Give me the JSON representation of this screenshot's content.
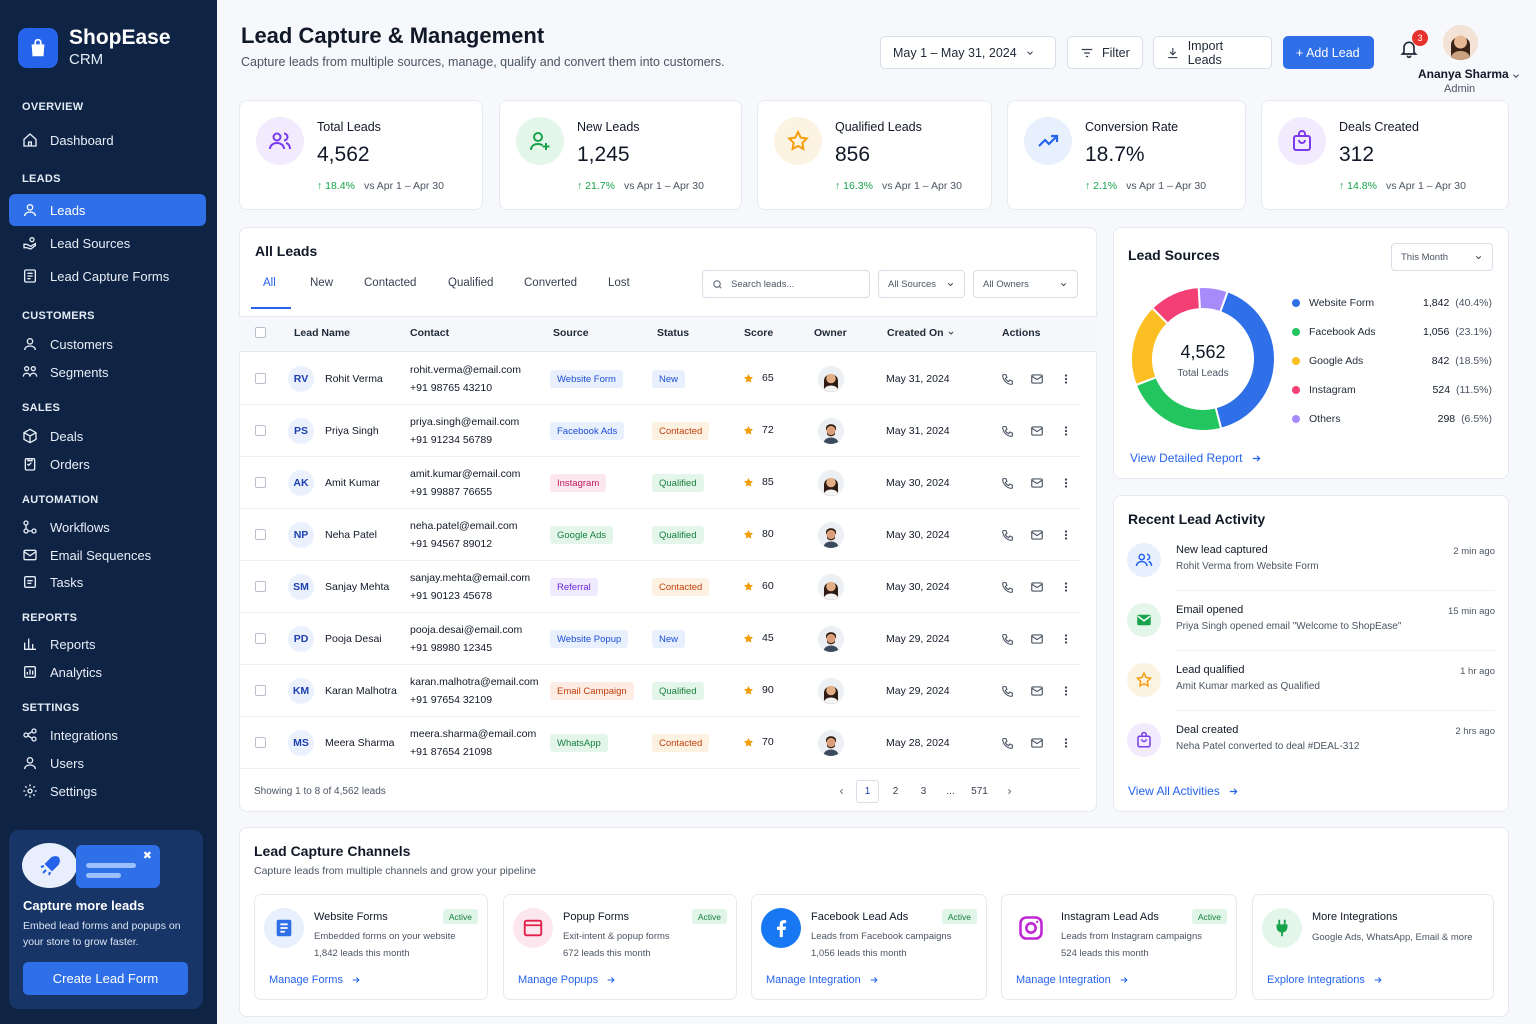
{
  "brand": {
    "name": "ShopEase",
    "sub": "CRM"
  },
  "nav": {
    "overview": "OVERVIEW",
    "dashboard": "Dashboard",
    "leads_section": "LEADS",
    "leads": "Leads",
    "lead_sources": "Lead Sources",
    "lead_capture_forms": "Lead Capture Forms",
    "customers_section": "CUSTOMERS",
    "customers": "Customers",
    "segments": "Segments",
    "sales_section": "SALES",
    "deals": "Deals",
    "orders": "Orders",
    "automation_section": "AUTOMATION",
    "workflows": "Workflows",
    "email_sequences": "Email Sequences",
    "tasks": "Tasks",
    "reports_section": "REPORTS",
    "reports": "Reports",
    "analytics": "Analytics",
    "settings_section": "SETTINGS",
    "integrations": "Integrations",
    "users": "Users",
    "settings": "Settings"
  },
  "promo": {
    "title": "Capture more leads",
    "desc": "Embed lead forms and popups on your store to grow faster.",
    "button": "Create Lead Form"
  },
  "header": {
    "title": "Lead Capture & Management",
    "subtitle": "Capture leads from multiple sources, manage, qualify and convert them into customers.",
    "date_range": "May 1 – May 31, 2024",
    "filter": "Filter",
    "import": "Import Leads",
    "add": "+ Add Lead",
    "notifications": "3",
    "user_name": "Ananya Sharma",
    "user_role": "Admin"
  },
  "stats": [
    {
      "label": "Total Leads",
      "value": "4,562",
      "change": "18.4%",
      "vs": "vs Apr 1 – Apr 30",
      "color": "#7c3aed",
      "bg": "#f1ebfd"
    },
    {
      "label": "New Leads",
      "value": "1,245",
      "change": "21.7%",
      "vs": "vs Apr 1 – Apr 30",
      "color": "#16a34a",
      "bg": "#e4f6ea"
    },
    {
      "label": "Qualified Leads",
      "value": "856",
      "change": "16.3%",
      "vs": "vs Apr 1 – Apr 30",
      "color": "#f59e0b",
      "bg": "#fdf3e2"
    },
    {
      "label": "Conversion Rate",
      "value": "18.7%",
      "change": "2.1%",
      "vs": "vs Apr 1 – Apr 30",
      "color": "#2563eb",
      "bg": "#e8f0fd"
    },
    {
      "label": "Deals Created",
      "value": "312",
      "change": "14.8%",
      "vs": "vs Apr 1 – Apr 30",
      "color": "#7c3aed",
      "bg": "#f1ebfd"
    }
  ],
  "leads": {
    "title": "All Leads",
    "tabs": [
      "All",
      "New",
      "Contacted",
      "Qualified",
      "Converted",
      "Lost"
    ],
    "search_placeholder": "Search leads...",
    "sources_filter": "All Sources",
    "owners_filter": "All Owners",
    "columns": [
      "Lead Name",
      "Contact",
      "Source",
      "Status",
      "Score",
      "Owner",
      "Created On",
      "Actions"
    ],
    "rows": [
      {
        "initials": "RV",
        "name": "Rohit Verma",
        "email": "rohit.verma@email.com",
        "phone": "+91 98765 43210",
        "source": "Website Form",
        "status": "New",
        "score": "65",
        "created": "May 31, 2024",
        "owner": "f"
      },
      {
        "initials": "PS",
        "name": "Priya Singh",
        "email": "priya.singh@email.com",
        "phone": "+91 91234 56789",
        "source": "Facebook Ads",
        "status": "Contacted",
        "score": "72",
        "created": "May 31, 2024",
        "owner": "m"
      },
      {
        "initials": "AK",
        "name": "Amit Kumar",
        "email": "amit.kumar@email.com",
        "phone": "+91 99887 76655",
        "source": "Instagram",
        "status": "Qualified",
        "score": "85",
        "created": "May 30, 2024",
        "owner": "f"
      },
      {
        "initials": "NP",
        "name": "Neha Patel",
        "email": "neha.patel@email.com",
        "phone": "+91 94567 89012",
        "source": "Google Ads",
        "status": "Qualified",
        "score": "80",
        "created": "May 30, 2024",
        "owner": "m"
      },
      {
        "initials": "SM",
        "name": "Sanjay Mehta",
        "email": "sanjay.mehta@email.com",
        "phone": "+91 90123 45678",
        "source": "Referral",
        "status": "Contacted",
        "score": "60",
        "created": "May 30, 2024",
        "owner": "f"
      },
      {
        "initials": "PD",
        "name": "Pooja Desai",
        "email": "pooja.desai@email.com",
        "phone": "+91 98980 12345",
        "source": "Website Popup",
        "status": "New",
        "score": "45",
        "created": "May 29, 2024",
        "owner": "m"
      },
      {
        "initials": "KM",
        "name": "Karan Malhotra",
        "email": "karan.malhotra@email.com",
        "phone": "+91 97654 32109",
        "source": "Email Campaign",
        "status": "Qualified",
        "score": "90",
        "created": "May 29, 2024",
        "owner": "f"
      },
      {
        "initials": "MS",
        "name": "Meera Sharma",
        "email": "meera.sharma@email.com",
        "phone": "+91 87654 21098",
        "source": "WhatsApp",
        "status": "Contacted",
        "score": "70",
        "created": "May 28, 2024",
        "owner": "m"
      }
    ],
    "showing": "Showing 1 to 8 of 4,562 leads",
    "pages": [
      "1",
      "2",
      "3",
      "...",
      "571"
    ]
  },
  "source_colors": {
    "Website Form": {
      "bg": "#e8f0fd",
      "fg": "#1d4ed8"
    },
    "Facebook Ads": {
      "bg": "#e8f0fd",
      "fg": "#1d4ed8"
    },
    "Instagram": {
      "bg": "#fde7ee",
      "fg": "#be185d"
    },
    "Google Ads": {
      "bg": "#e4f6ea",
      "fg": "#15803d"
    },
    "Referral": {
      "bg": "#efeafd",
      "fg": "#6d28d9"
    },
    "Website Popup": {
      "bg": "#e8f0fd",
      "fg": "#1d4ed8"
    },
    "Email Campaign": {
      "bg": "#fdece4",
      "fg": "#c2410c"
    },
    "WhatsApp": {
      "bg": "#e4f6ea",
      "fg": "#15803d"
    }
  },
  "status_colors": {
    "New": {
      "bg": "#e8f0fd",
      "fg": "#1d4ed8"
    },
    "Contacted": {
      "bg": "#fdf1e2",
      "fg": "#c2410c"
    },
    "Qualified": {
      "bg": "#e4f6ea",
      "fg": "#15803d"
    }
  },
  "lead_sources": {
    "title": "Lead Sources",
    "period": "This Month",
    "total": "4,562",
    "total_label": "Total Leads",
    "items": [
      {
        "name": "Website Form",
        "value": 1842,
        "display": "1,842",
        "pct": "(40.4%)",
        "color": "#2f6fe8"
      },
      {
        "name": "Facebook Ads",
        "value": 1056,
        "display": "1,056",
        "pct": "(23.1%)",
        "color": "#22c55e"
      },
      {
        "name": "Google Ads",
        "value": 842,
        "display": "842",
        "pct": "(18.5%)",
        "color": "#fbbf24"
      },
      {
        "name": "Instagram",
        "value": 524,
        "display": "524",
        "pct": "(11.5%)",
        "color": "#f43f74"
      },
      {
        "name": "Others",
        "value": 298,
        "display": "298",
        "pct": "(6.5%)",
        "color": "#a78bfa"
      }
    ],
    "report_link": "View Detailed Report"
  },
  "activity": {
    "title": "Recent Lead Activity",
    "items": [
      {
        "title": "New lead captured",
        "desc": "Rohit Verma from Website Form",
        "time": "2 min ago",
        "icon": "users-icon",
        "color": "#2563eb",
        "bg": "#e8f0fd"
      },
      {
        "title": "Email opened",
        "desc": "Priya Singh opened email \"Welcome to ShopEase\"",
        "time": "15 min ago",
        "icon": "mail-icon",
        "color": "#16a34a",
        "bg": "#e4f6ea"
      },
      {
        "title": "Lead qualified",
        "desc": "Amit Kumar marked as Qualified",
        "time": "1 hr ago",
        "icon": "star-icon",
        "color": "#f59e0b",
        "bg": "#fdf3e2"
      },
      {
        "title": "Deal created",
        "desc": "Neha Patel converted to deal #DEAL-312",
        "time": "2 hrs ago",
        "icon": "bag-icon",
        "color": "#7c3aed",
        "bg": "#f1ebfd"
      }
    ],
    "link": "View All Activities"
  },
  "channels": {
    "title": "Lead Capture Channels",
    "subtitle": "Capture leads from multiple channels and grow your pipeline",
    "items": [
      {
        "name": "Website Forms",
        "active": "Active",
        "desc": "Embedded forms on your website",
        "count": "1,842 leads this month",
        "link": "Manage Forms"
      },
      {
        "name": "Popup Forms",
        "active": "Active",
        "desc": "Exit-intent & popup forms",
        "count": "672 leads this month",
        "link": "Manage Popups"
      },
      {
        "name": "Facebook Lead Ads",
        "active": "Active",
        "desc": "Leads from Facebook campaigns",
        "count": "1,056 leads this month",
        "link": "Manage Integration"
      },
      {
        "name": "Instagram Lead Ads",
        "active": "Active",
        "desc": "Leads from Instagram campaigns",
        "count": "524 leads this month",
        "link": "Manage Integration"
      },
      {
        "name": "More Integrations",
        "active": "",
        "desc": "Google Ads, WhatsApp, Email & more",
        "count": "",
        "link": "Explore Integrations"
      }
    ]
  }
}
